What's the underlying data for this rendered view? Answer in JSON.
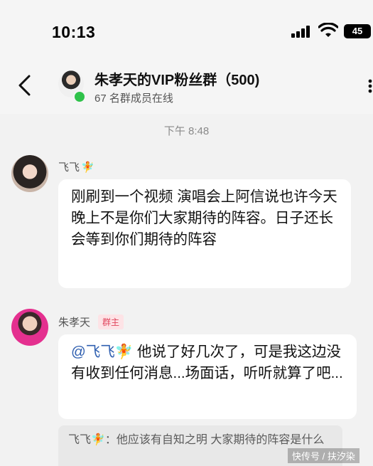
{
  "status_bar": {
    "time": "10:13",
    "battery": "45"
  },
  "header": {
    "title": "朱孝天的VIP粉丝群（500)",
    "subtitle": "67 名群成员在线"
  },
  "chat": {
    "timestamp": "下午 8:48",
    "messages": [
      {
        "sender": "飞飞",
        "sender_emoji": "🧚",
        "text": "刚刷到一个视频 演唱会上阿信说也许今天晚上不是你们大家期待的阵容。日子还长 会等到你们期待的阵容"
      },
      {
        "sender": "朱孝天",
        "badge": "群主",
        "mention": "@飞飞🧚",
        "text": " 他说了好几次了，可是我这边没有收到任何消息...场面话，听听就算了吧...",
        "quote": "飞飞🧚：他应该有自知之明  大家期待的阵容是什么"
      }
    ]
  },
  "watermark": "快传号 / 扶汐染"
}
